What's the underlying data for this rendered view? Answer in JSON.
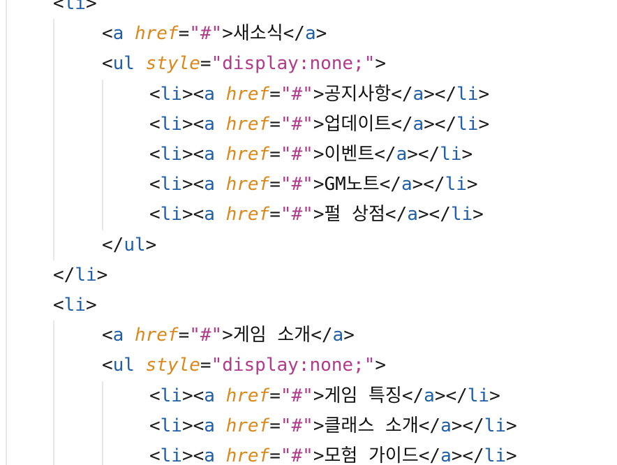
{
  "colors": {
    "background": "#ffffff",
    "tag": "#1f5fa8",
    "attribute": "#d9891b",
    "string": "#b03b8a",
    "text": "#111111",
    "guide": "#e8e8e8"
  },
  "lines": [
    {
      "indent": 1,
      "tokens": [
        [
          "punc",
          "<"
        ],
        [
          "tag",
          "li"
        ],
        [
          "punc",
          ">"
        ]
      ]
    },
    {
      "indent": 2,
      "tokens": [
        [
          "punc",
          "<"
        ],
        [
          "tag",
          "a"
        ],
        [
          "text",
          " "
        ],
        [
          "attr",
          "href"
        ],
        [
          "eq",
          "="
        ],
        [
          "str",
          "\"#\""
        ],
        [
          "punc",
          ">"
        ],
        [
          "text",
          "새소식"
        ],
        [
          "punc",
          "</"
        ],
        [
          "tag",
          "a"
        ],
        [
          "punc",
          ">"
        ]
      ]
    },
    {
      "indent": 2,
      "tokens": [
        [
          "punc",
          "<"
        ],
        [
          "tag",
          "ul"
        ],
        [
          "text",
          " "
        ],
        [
          "attr",
          "style"
        ],
        [
          "eq",
          "="
        ],
        [
          "str",
          "\"display:none;\""
        ],
        [
          "punc",
          ">"
        ]
      ]
    },
    {
      "indent": 3,
      "tokens": [
        [
          "punc",
          "<"
        ],
        [
          "tag",
          "li"
        ],
        [
          "punc",
          "><"
        ],
        [
          "tag",
          "a"
        ],
        [
          "text",
          " "
        ],
        [
          "attr",
          "href"
        ],
        [
          "eq",
          "="
        ],
        [
          "str",
          "\"#\""
        ],
        [
          "punc",
          ">"
        ],
        [
          "text",
          "공지사항"
        ],
        [
          "punc",
          "</"
        ],
        [
          "tag",
          "a"
        ],
        [
          "punc",
          "></"
        ],
        [
          "tag",
          "li"
        ],
        [
          "punc",
          ">"
        ]
      ]
    },
    {
      "indent": 3,
      "tokens": [
        [
          "punc",
          "<"
        ],
        [
          "tag",
          "li"
        ],
        [
          "punc",
          "><"
        ],
        [
          "tag",
          "a"
        ],
        [
          "text",
          " "
        ],
        [
          "attr",
          "href"
        ],
        [
          "eq",
          "="
        ],
        [
          "str",
          "\"#\""
        ],
        [
          "punc",
          ">"
        ],
        [
          "text",
          "업데이트"
        ],
        [
          "punc",
          "</"
        ],
        [
          "tag",
          "a"
        ],
        [
          "punc",
          "></"
        ],
        [
          "tag",
          "li"
        ],
        [
          "punc",
          ">"
        ]
      ]
    },
    {
      "indent": 3,
      "tokens": [
        [
          "punc",
          "<"
        ],
        [
          "tag",
          "li"
        ],
        [
          "punc",
          "><"
        ],
        [
          "tag",
          "a"
        ],
        [
          "text",
          " "
        ],
        [
          "attr",
          "href"
        ],
        [
          "eq",
          "="
        ],
        [
          "str",
          "\"#\""
        ],
        [
          "punc",
          ">"
        ],
        [
          "text",
          "이벤트"
        ],
        [
          "punc",
          "</"
        ],
        [
          "tag",
          "a"
        ],
        [
          "punc",
          "></"
        ],
        [
          "tag",
          "li"
        ],
        [
          "punc",
          ">"
        ]
      ]
    },
    {
      "indent": 3,
      "tokens": [
        [
          "punc",
          "<"
        ],
        [
          "tag",
          "li"
        ],
        [
          "punc",
          "><"
        ],
        [
          "tag",
          "a"
        ],
        [
          "text",
          " "
        ],
        [
          "attr",
          "href"
        ],
        [
          "eq",
          "="
        ],
        [
          "str",
          "\"#\""
        ],
        [
          "punc",
          ">"
        ],
        [
          "text",
          "GM노트"
        ],
        [
          "punc",
          "</"
        ],
        [
          "tag",
          "a"
        ],
        [
          "punc",
          "></"
        ],
        [
          "tag",
          "li"
        ],
        [
          "punc",
          ">"
        ]
      ]
    },
    {
      "indent": 3,
      "tokens": [
        [
          "punc",
          "<"
        ],
        [
          "tag",
          "li"
        ],
        [
          "punc",
          "><"
        ],
        [
          "tag",
          "a"
        ],
        [
          "text",
          " "
        ],
        [
          "attr",
          "href"
        ],
        [
          "eq",
          "="
        ],
        [
          "str",
          "\"#\""
        ],
        [
          "punc",
          ">"
        ],
        [
          "text",
          "펄 상점"
        ],
        [
          "punc",
          "</"
        ],
        [
          "tag",
          "a"
        ],
        [
          "punc",
          "></"
        ],
        [
          "tag",
          "li"
        ],
        [
          "punc",
          ">"
        ]
      ]
    },
    {
      "indent": 2,
      "tokens": [
        [
          "punc",
          "</"
        ],
        [
          "tag",
          "ul"
        ],
        [
          "punc",
          ">"
        ]
      ]
    },
    {
      "indent": 1,
      "tokens": [
        [
          "punc",
          "</"
        ],
        [
          "tag",
          "li"
        ],
        [
          "punc",
          ">"
        ]
      ]
    },
    {
      "indent": 1,
      "tokens": [
        [
          "punc",
          "<"
        ],
        [
          "tag",
          "li"
        ],
        [
          "punc",
          ">"
        ]
      ]
    },
    {
      "indent": 2,
      "tokens": [
        [
          "punc",
          "<"
        ],
        [
          "tag",
          "a"
        ],
        [
          "text",
          " "
        ],
        [
          "attr",
          "href"
        ],
        [
          "eq",
          "="
        ],
        [
          "str",
          "\"#\""
        ],
        [
          "punc",
          ">"
        ],
        [
          "text",
          "게임 소개"
        ],
        [
          "punc",
          "</"
        ],
        [
          "tag",
          "a"
        ],
        [
          "punc",
          ">"
        ]
      ]
    },
    {
      "indent": 2,
      "tokens": [
        [
          "punc",
          "<"
        ],
        [
          "tag",
          "ul"
        ],
        [
          "text",
          " "
        ],
        [
          "attr",
          "style"
        ],
        [
          "eq",
          "="
        ],
        [
          "str",
          "\"display:none;\""
        ],
        [
          "punc",
          ">"
        ]
      ]
    },
    {
      "indent": 3,
      "tokens": [
        [
          "punc",
          "<"
        ],
        [
          "tag",
          "li"
        ],
        [
          "punc",
          "><"
        ],
        [
          "tag",
          "a"
        ],
        [
          "text",
          " "
        ],
        [
          "attr",
          "href"
        ],
        [
          "eq",
          "="
        ],
        [
          "str",
          "\"#\""
        ],
        [
          "punc",
          ">"
        ],
        [
          "text",
          "게임 특징"
        ],
        [
          "punc",
          "</"
        ],
        [
          "tag",
          "a"
        ],
        [
          "punc",
          "></"
        ],
        [
          "tag",
          "li"
        ],
        [
          "punc",
          ">"
        ]
      ]
    },
    {
      "indent": 3,
      "tokens": [
        [
          "punc",
          "<"
        ],
        [
          "tag",
          "li"
        ],
        [
          "punc",
          "><"
        ],
        [
          "tag",
          "a"
        ],
        [
          "text",
          " "
        ],
        [
          "attr",
          "href"
        ],
        [
          "eq",
          "="
        ],
        [
          "str",
          "\"#\""
        ],
        [
          "punc",
          ">"
        ],
        [
          "text",
          "클래스 소개"
        ],
        [
          "punc",
          "</"
        ],
        [
          "tag",
          "a"
        ],
        [
          "punc",
          "></"
        ],
        [
          "tag",
          "li"
        ],
        [
          "punc",
          ">"
        ]
      ]
    },
    {
      "indent": 3,
      "tokens": [
        [
          "punc",
          "<"
        ],
        [
          "tag",
          "li"
        ],
        [
          "punc",
          "><"
        ],
        [
          "tag",
          "a"
        ],
        [
          "text",
          " "
        ],
        [
          "attr",
          "href"
        ],
        [
          "eq",
          "="
        ],
        [
          "str",
          "\"#\""
        ],
        [
          "punc",
          ">"
        ],
        [
          "text",
          "모험 가이드"
        ],
        [
          "punc",
          "</"
        ],
        [
          "tag",
          "a"
        ],
        [
          "punc",
          "></"
        ],
        [
          "tag",
          "li"
        ],
        [
          "punc",
          ">"
        ]
      ]
    }
  ]
}
